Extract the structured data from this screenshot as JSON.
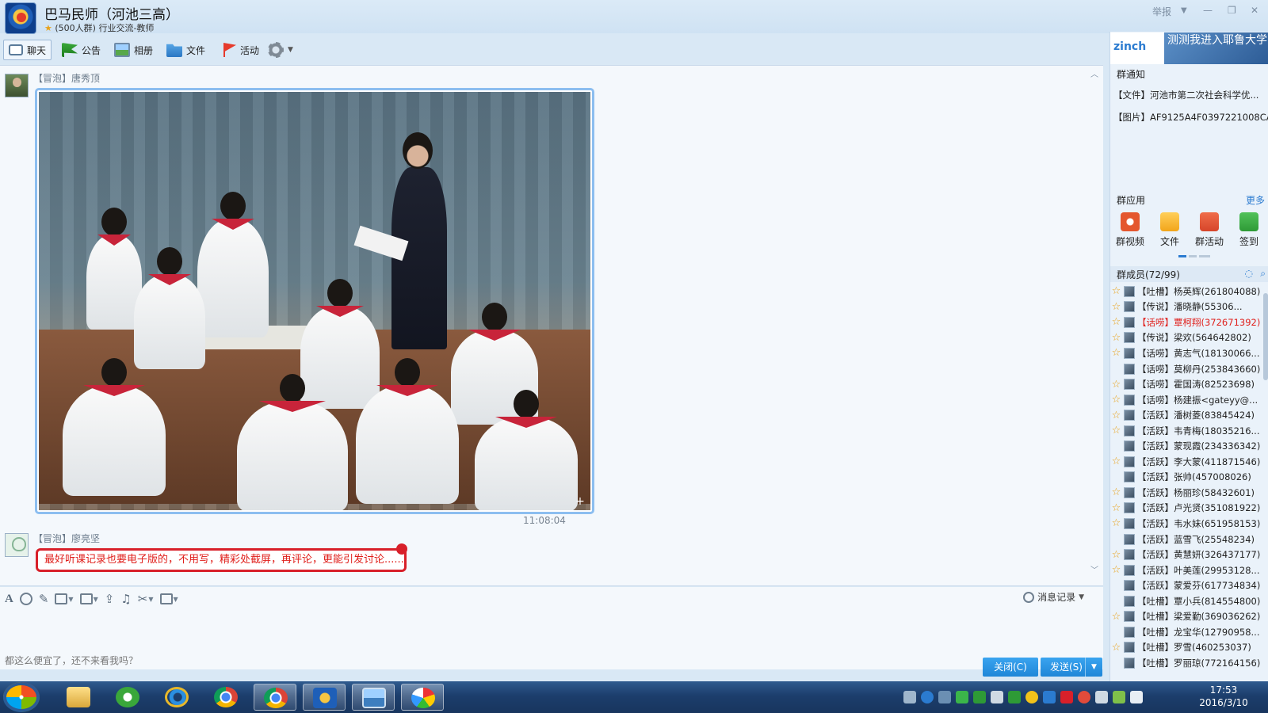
{
  "window": {
    "title": "巴马民师（河池三高）",
    "subtitle": "(500人群) 行业交流-教师",
    "report_label": "举报",
    "min_glyph": "—",
    "max_glyph": "❐",
    "close_glyph": "✕",
    "menu_glyph": "▼"
  },
  "toolbar": {
    "chat": "聊天",
    "notice": "公告",
    "album": "相册",
    "file": "文件",
    "activity": "活动"
  },
  "messages": [
    {
      "sender": "【冒泡】唐秀顶",
      "time": "11:08:04"
    },
    {
      "sender": "【冒泡】廖亮坚",
      "text": "最好听课记录也要电子版的，不用写，精彩处截屏，再评论，更能引发讨论......"
    }
  ],
  "input": {
    "text": "都这么便宜了，还不来看我吗？",
    "history": "消息记录",
    "close": "关闭(C)",
    "send": "发送(S)"
  },
  "right_panel": {
    "ad_logo": "zinch",
    "ad_text": "测测我进入耶鲁大学的几率",
    "notice_title": "群通知",
    "notices": [
      "【文件】河池市第二次社会科学优...",
      "【图片】AF9125A4F0397221008CA..."
    ],
    "apps_title": "群应用",
    "apps_more": "更多",
    "apps": [
      "群视频",
      "文件",
      "群活动",
      "签到"
    ],
    "members_title": "群成员(72/99)",
    "members": [
      {
        "name": "【吐槽】杨英辉(261804088)",
        "star": true,
        "highlight": false
      },
      {
        "name": "【传说】潘晓静(55306...",
        "star": true,
        "highlight": false
      },
      {
        "name": "【话唠】覃柯翔(372671392)",
        "star": true,
        "highlight": true
      },
      {
        "name": "【传说】梁欢(564642802)",
        "star": true,
        "highlight": false
      },
      {
        "name": "【话唠】黄志气(18130066...",
        "star": true,
        "highlight": false
      },
      {
        "name": "【话唠】莫柳丹(253843660)",
        "star": false,
        "highlight": false
      },
      {
        "name": "【话唠】霍国涛(82523698)",
        "star": true,
        "highlight": false
      },
      {
        "name": "【话唠】杨建振<gateyy@...",
        "star": true,
        "highlight": false
      },
      {
        "name": "【活跃】潘树菱(83845424)",
        "star": true,
        "highlight": false
      },
      {
        "name": "【活跃】韦青梅(18035216...",
        "star": true,
        "highlight": false
      },
      {
        "name": "【活跃】蒙现霞(234336342)",
        "star": false,
        "highlight": false
      },
      {
        "name": "【活跃】李大蒙(411871546)",
        "star": true,
        "highlight": false
      },
      {
        "name": "【活跃】张帅(457008026)",
        "star": false,
        "highlight": false
      },
      {
        "name": "【活跃】杨丽珍(58432601)",
        "star": true,
        "highlight": false
      },
      {
        "name": "【活跃】卢光贤(351081922)",
        "star": true,
        "highlight": false
      },
      {
        "name": "【活跃】韦水妹(651958153)",
        "star": true,
        "highlight": false
      },
      {
        "name": "【活跃】蓝雪飞(25548234)",
        "star": false,
        "highlight": false
      },
      {
        "name": "【活跃】黄慧妍(326437177)",
        "star": true,
        "highlight": false
      },
      {
        "name": "【活跃】叶美莲(29953128...",
        "star": true,
        "highlight": false
      },
      {
        "name": "【活跃】蒙爱芬(617734834)",
        "star": false,
        "highlight": false
      },
      {
        "name": "【吐槽】覃小兵(814554800)",
        "star": false,
        "highlight": false
      },
      {
        "name": "【吐槽】梁爱勤(369036262)",
        "star": true,
        "highlight": false
      },
      {
        "name": "【吐槽】龙宝华(12790958...",
        "star": false,
        "highlight": false
      },
      {
        "name": "【吐槽】罗雪(460253037)",
        "star": true,
        "highlight": false
      },
      {
        "name": "【吐槽】罗丽琼(772164156)",
        "star": false,
        "highlight": false
      }
    ]
  },
  "taskbar": {
    "time": "17:53",
    "date": "2016/3/10"
  },
  "colors": {
    "accent": "#1f86d8",
    "bubble_border": "#d8202a",
    "bubble_text": "#e0201c",
    "member_highlight": "#e0201c",
    "star": "#e8a21a"
  }
}
